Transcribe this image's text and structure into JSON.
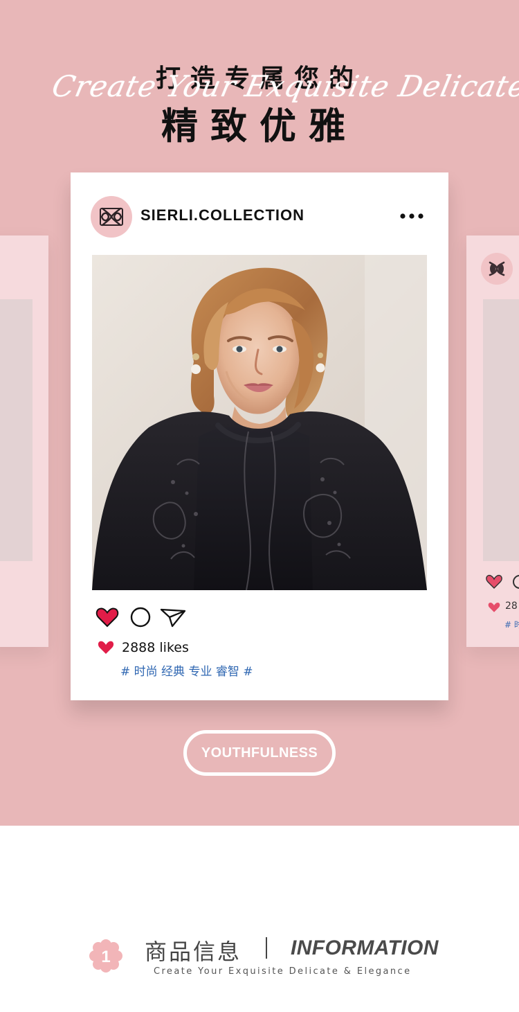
{
  "hero": {
    "heading_small": "打造专属您的",
    "heading_large": "精致优雅",
    "script_text": "Create Your Exquisite Delicate & Elegance",
    "background_color": "#e8b7b8"
  },
  "post_card": {
    "account_name": "SIERLI.COLLECTION",
    "more_icon": "more-dots-icon",
    "likes_text": "2888 likes",
    "hashtags": "# 时尚 经典 专业 睿智 #",
    "like_color": "#e11d48",
    "hashtag_color": "#2f67b2"
  },
  "side_card_right": {
    "likes_preview": "28",
    "tags_preview": "# 时"
  },
  "badge": {
    "label": "YOUTHFULNESS"
  },
  "section": {
    "number": "1",
    "title_cn": "商品信息",
    "title_en": "INFORMATION",
    "subtitle": "Create Your Exquisite Delicate & Elegance"
  }
}
